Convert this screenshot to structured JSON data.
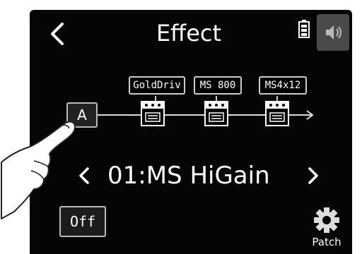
{
  "header": {
    "title": "Effect",
    "back_icon": "chevron-left-icon",
    "battery_icon": "battery-icon",
    "volume_icon": "speaker-icon"
  },
  "chain": {
    "input_label": "A",
    "effects": [
      {
        "label": "GoldDriv",
        "icon": "pedal-icon"
      },
      {
        "label": "MS 800",
        "icon": "pedal-icon"
      },
      {
        "label": "MS4x12",
        "icon": "pedal-icon"
      }
    ]
  },
  "preset": {
    "name": "01:MS HiGain",
    "prev_icon": "chevron-left-icon",
    "next_icon": "chevron-right-icon"
  },
  "controls": {
    "off_label": "Off",
    "patch_label": "Patch",
    "patch_icon": "gear-icon"
  },
  "colors": {
    "background": "#050505",
    "text": "#ffffff",
    "tab": "#4a4a4a"
  }
}
